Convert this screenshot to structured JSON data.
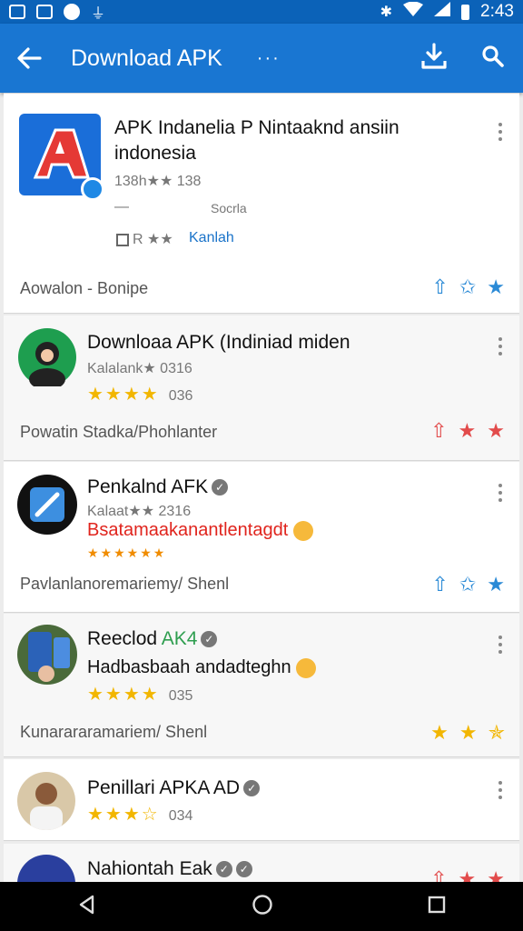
{
  "status_bar": {
    "time": "2:43",
    "icons": [
      "gallery-icon",
      "mail-icon",
      "alert-icon",
      "usb-icon",
      "bluetooth-icon",
      "wifi-icon",
      "signal-icon",
      "battery-icon"
    ]
  },
  "app_bar": {
    "title": "Download APK",
    "more": "···",
    "color": "#1976d2"
  },
  "cards": [
    {
      "title_line1": "APK Indanelia P Nintaaknd ansiin",
      "title_line2": "indonesia",
      "rating_text": "138h★★ 138",
      "dash": "—",
      "meta": "Socrla",
      "chip": "R ★★",
      "link": "Kanlah",
      "footer": "Aowalon  -  Bonipe"
    },
    {
      "title": "Downloaa APK (Indiniad  miden",
      "sub": "Kalalank★ 0316",
      "stars": "★★★★",
      "count": "036",
      "footer": "Powatin Stadka/Phohlanter"
    },
    {
      "title": "Penkalnd AFK",
      "sub": "Kalaat★★ 2316",
      "promo": "Bsatamaakanantlentagdt",
      "stars": "★★★★★★",
      "footer": "Pavlanlanoremariemy/    Shenl"
    },
    {
      "title_a": "Reeclod",
      "title_b": "AK4",
      "sub": "Hadbasbaah andadteghn",
      "stars": "★★★★",
      "count": "035",
      "footer": "Kunarararamariem/    Shenl"
    },
    {
      "title": "Penillari APKA AD",
      "stars": "★★★☆",
      "count": "034"
    },
    {
      "title": "Nahiontah Eak"
    }
  ],
  "colors": {
    "star": "#f2b600",
    "blue_action": "#2b8ad6",
    "red_action": "#e24b4b",
    "link": "#1a73c9",
    "promo": "#e0241d"
  }
}
